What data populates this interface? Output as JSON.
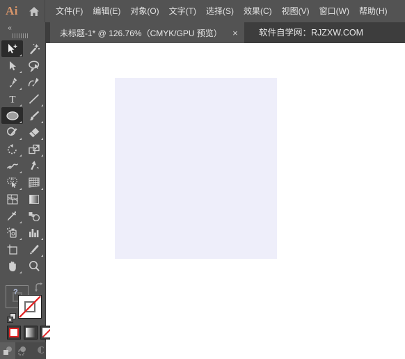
{
  "app": {
    "name": "Ai",
    "logo_color": "#d8956a",
    "home_icon": "home-icon"
  },
  "menubar": {
    "items": [
      {
        "label": "文件(F)",
        "name": "menu-file"
      },
      {
        "label": "编辑(E)",
        "name": "menu-edit"
      },
      {
        "label": "对象(O)",
        "name": "menu-object"
      },
      {
        "label": "文字(T)",
        "name": "menu-type"
      },
      {
        "label": "选择(S)",
        "name": "menu-select"
      },
      {
        "label": "效果(C)",
        "name": "menu-effect"
      },
      {
        "label": "视图(V)",
        "name": "menu-view"
      },
      {
        "label": "窗口(W)",
        "name": "menu-window"
      },
      {
        "label": "帮助(H)",
        "name": "menu-help"
      }
    ]
  },
  "tabbar": {
    "document_tab": {
      "label": "未标题-1* @ 126.76%（CMYK/GPU 预览）",
      "close_label": "×",
      "active": true
    },
    "watermark": "软件自学网：RJZXW.COM"
  },
  "toolpanel": {
    "collapse_label": "«",
    "tools": [
      {
        "name": "selection-tool",
        "label": "选择工具",
        "selected": true,
        "has_flyout": true
      },
      {
        "name": "magic-wand-tool",
        "label": "魔棒工具",
        "selected": false,
        "has_flyout": false
      },
      {
        "name": "direct-selection-tool",
        "label": "直接选择工具",
        "selected": false,
        "has_flyout": true
      },
      {
        "name": "lasso-tool",
        "label": "套索工具",
        "selected": false,
        "has_flyout": false
      },
      {
        "name": "pen-tool",
        "label": "钢笔工具",
        "selected": false,
        "has_flyout": true
      },
      {
        "name": "curvature-tool",
        "label": "曲率工具",
        "selected": false,
        "has_flyout": false
      },
      {
        "name": "type-tool",
        "label": "文字工具",
        "selected": false,
        "has_flyout": true
      },
      {
        "name": "line-segment-tool",
        "label": "直线段工具",
        "selected": false,
        "has_flyout": true
      },
      {
        "name": "ellipse-tool",
        "label": "椭圆工具",
        "selected": true,
        "has_flyout": true
      },
      {
        "name": "paintbrush-tool",
        "label": "画笔工具",
        "selected": false,
        "has_flyout": true
      },
      {
        "name": "shaper-pencil-tool",
        "label": "Shaper 工具",
        "selected": false,
        "has_flyout": true
      },
      {
        "name": "eraser-tool",
        "label": "橡皮擦工具",
        "selected": false,
        "has_flyout": true
      },
      {
        "name": "rotate-tool",
        "label": "旋转工具",
        "selected": false,
        "has_flyout": true
      },
      {
        "name": "scale-tool",
        "label": "比例缩放工具",
        "selected": false,
        "has_flyout": true
      },
      {
        "name": "width-tool",
        "label": "宽度工具",
        "selected": false,
        "has_flyout": true
      },
      {
        "name": "free-transform-tool",
        "label": "自由变换工具",
        "selected": false,
        "has_flyout": false
      },
      {
        "name": "shape-builder-tool",
        "label": "形状生成器工具",
        "selected": false,
        "has_flyout": true
      },
      {
        "name": "perspective-grid-tool",
        "label": "透视网格工具",
        "selected": false,
        "has_flyout": true
      },
      {
        "name": "mesh-tool",
        "label": "网格工具",
        "selected": false,
        "has_flyout": false
      },
      {
        "name": "gradient-tool",
        "label": "渐变工具",
        "selected": false,
        "has_flyout": false
      },
      {
        "name": "eyedropper-tool",
        "label": "吸管工具",
        "selected": false,
        "has_flyout": true
      },
      {
        "name": "blend-tool",
        "label": "混合工具",
        "selected": false,
        "has_flyout": false
      },
      {
        "name": "symbol-sprayer-tool",
        "label": "符号喷枪工具",
        "selected": false,
        "has_flyout": true
      },
      {
        "name": "column-graph-tool",
        "label": "柱形图工具",
        "selected": false,
        "has_flyout": true
      },
      {
        "name": "artboard-tool",
        "label": "画板工具",
        "selected": false,
        "has_flyout": false
      },
      {
        "name": "slice-tool",
        "label": "切片工具",
        "selected": false,
        "has_flyout": true
      },
      {
        "name": "hand-tool",
        "label": "抓手工具",
        "selected": false,
        "has_flyout": true
      },
      {
        "name": "zoom-tool",
        "label": "缩放工具",
        "selected": false,
        "has_flyout": false
      }
    ],
    "fill_stroke": {
      "fill_name": "fill-swatch",
      "fill_state": "none",
      "stroke_name": "stroke-swatch",
      "stroke_state": "unknown",
      "stroke_marker": "?",
      "swap_label": "swap-fill-stroke-icon",
      "default_label": "default-fill-stroke-icon",
      "slash_color": "#e02222"
    },
    "color_modes": [
      {
        "name": "color-mode-button",
        "label": "颜色"
      },
      {
        "name": "gradient-mode-button",
        "label": "渐变"
      },
      {
        "name": "none-mode-button",
        "label": "无",
        "active": true
      }
    ],
    "draw_modes": [
      {
        "name": "draw-normal-button",
        "label": "正常绘图",
        "active": true
      },
      {
        "name": "draw-behind-button",
        "label": "背面绘图",
        "active": false
      },
      {
        "name": "draw-inside-button",
        "label": "内部绘图",
        "active": false
      }
    ]
  },
  "canvas": {
    "background_color": "#ffffff",
    "artboard": {
      "name": "artboard",
      "fill_color": "#eeeefa",
      "zoom_percent": "126.76%"
    }
  }
}
